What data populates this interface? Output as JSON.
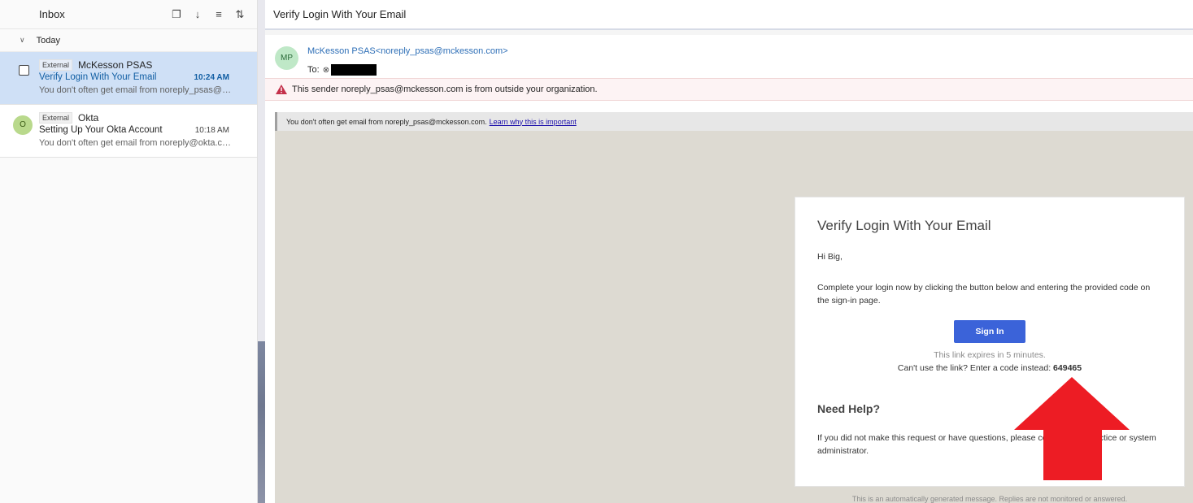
{
  "inbox": {
    "title": "Inbox",
    "toolbar_icons": [
      "select-icon",
      "jump-icon",
      "filter-icon",
      "sort-icon"
    ],
    "group_label": "Today",
    "messages": [
      {
        "tag": "External",
        "sender": "McKesson PSAS",
        "subject": "Verify Login With Your Email",
        "time": "10:24 AM",
        "preview": "You don't often get email from noreply_psas@mckesson.com",
        "selected": true
      },
      {
        "avatar": "O",
        "tag": "External",
        "sender": "Okta",
        "subject": "Setting Up Your Okta Account",
        "time": "10:18 AM",
        "preview": "You don't often get email from noreply@okta.com",
        "selected": false
      }
    ]
  },
  "reading": {
    "subject": "Verify Login With Your Email",
    "avatar": "MP",
    "from": "McKesson PSAS<noreply_psas@mckesson.com>",
    "to_label": "To:",
    "warning": "This sender noreply_psas@mckesson.com is from outside your organization.",
    "banner_text": "You don't often get email from noreply_psas@mckesson.com.",
    "banner_link": "Learn why this is important"
  },
  "email": {
    "title": "Verify Login With Your Email",
    "greeting": "Hi Big,",
    "instructions": "Complete your login now by clicking the button below and entering the provided code on the sign-in page.",
    "button_label": "Sign In",
    "expires": "This link expires in 5 minutes.",
    "code_prompt": "Can't use the link? Enter a code instead:",
    "code": "649465",
    "help_title": "Need Help?",
    "help_text": "If you did not make this request or have questions, please contact your practice or system administrator.",
    "footer": "This is an automatically generated message. Replies are not monitored or answered."
  },
  "colors": {
    "accent": "#115ea3",
    "selected_row": "#cfe0f6",
    "button": "#3b63d9",
    "annotation_arrow": "#ed1c24"
  }
}
